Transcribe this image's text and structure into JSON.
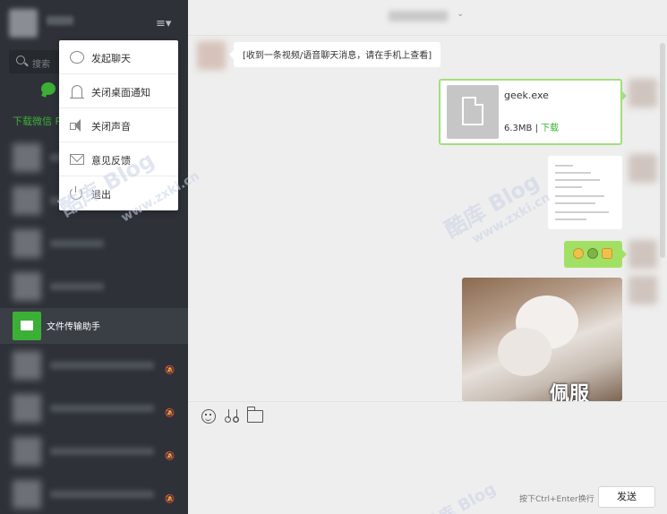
{
  "sidebar": {
    "search": {
      "placeholder": "搜索"
    },
    "download_banner": "下载微信 P",
    "conversations": [
      {
        "type": "blurred"
      },
      {
        "type": "blurred"
      },
      {
        "type": "blurred"
      },
      {
        "type": "blurred"
      },
      {
        "type": "active",
        "name": "文件传输助手"
      },
      {
        "type": "blurred",
        "muted": true
      },
      {
        "type": "blurred",
        "muted": true
      },
      {
        "type": "blurred",
        "muted": true
      },
      {
        "type": "blurred",
        "muted": true
      }
    ]
  },
  "menu": {
    "items": [
      {
        "label": "发起聊天",
        "icon": "chat-bubble-icon"
      },
      {
        "label": "关闭桌面通知",
        "icon": "bell-icon"
      },
      {
        "label": "关闭声音",
        "icon": "speaker-icon"
      },
      {
        "label": "意见反馈",
        "icon": "mail-icon"
      },
      {
        "label": "退出",
        "icon": "power-icon"
      }
    ]
  },
  "chat": {
    "incoming_notice": "[收到一条视频/语音聊天消息，请在手机上查看]",
    "file": {
      "name": "geek.exe",
      "size": "6.3MB",
      "separator": "|",
      "download_label": "下载"
    },
    "image_caption": "佩服"
  },
  "composer": {
    "hint": "按下Ctrl+Enter换行",
    "send_label": "发送"
  },
  "watermark": {
    "text_cn": "酷库 Blog",
    "text_url": "www.zxki.cn"
  },
  "colors": {
    "accent_green": "#3caf36",
    "bubble_green": "#a2e065",
    "sidebar_bg": "#2e3238"
  }
}
